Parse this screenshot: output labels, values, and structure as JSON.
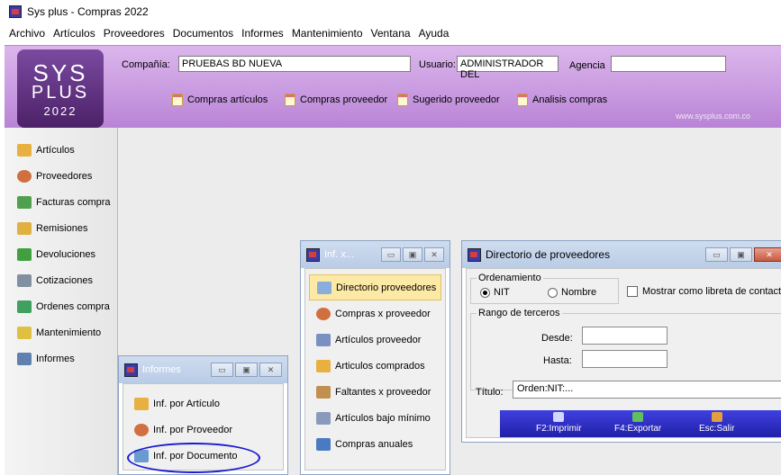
{
  "window": {
    "title": "Sys plus - Compras 2022"
  },
  "menu": [
    "Archivo",
    "Artículos",
    "Proveedores",
    "Documentos",
    "Informes",
    "Mantenimiento",
    "Ventana",
    "Ayuda"
  ],
  "logo": {
    "line1": "SYS",
    "line2": "PLUS",
    "year": "2022"
  },
  "header": {
    "company_label": "Compañía:",
    "company_value": "PRUEBAS BD NUEVA",
    "user_label": "Usuario:",
    "user_value": "ADMINISTRADOR DEL",
    "agency_label": "Agencia",
    "agency_value": "",
    "url": "www.sysplus.com.co"
  },
  "toolbar": [
    "Compras artículos",
    "Compras proveedor",
    "Sugerido proveedor",
    "Analisis compras"
  ],
  "sidebar": [
    {
      "label": "Artículos",
      "icon": "box-icon",
      "color": "#e8b040"
    },
    {
      "label": "Proveedores",
      "icon": "person-icon",
      "color": "#d07040"
    },
    {
      "label": "Facturas compra",
      "icon": "invoice-icon",
      "color": "#50a050"
    },
    {
      "label": "Remisiones",
      "icon": "remission-icon",
      "color": "#e0b040"
    },
    {
      "label": "Devoluciones",
      "icon": "return-icon",
      "color": "#40a040"
    },
    {
      "label": "Cotizaciones",
      "icon": "quote-icon",
      "color": "#8090a0"
    },
    {
      "label": "Ordenes compra",
      "icon": "order-icon",
      "color": "#40a060"
    },
    {
      "label": "Mantenimiento",
      "icon": "wrench-icon",
      "color": "#e0c040"
    },
    {
      "label": "Informes",
      "icon": "printer-icon",
      "color": "#6080b0"
    }
  ],
  "informes": {
    "title": "Informes",
    "items": [
      "Inf. por Artículo",
      "Inf. por Proveedor",
      "Inf. por Documento"
    ]
  },
  "infx": {
    "title": "Inf. x...",
    "items": [
      "Directorio proveedores",
      "Compras x proveedor",
      "Artículos proveedor",
      "Articulos comprados",
      "Faltantes x proveedor",
      "Artículos bajo mínimo",
      "Compras anuales"
    ]
  },
  "directorio": {
    "title": "Directorio de proveedores",
    "ordering_label": "Ordenamiento",
    "opt_nit": "NIT",
    "opt_nombre": "Nombre",
    "checkbox_label": "Mostrar como libreta de contactos",
    "range_label": "Rango de terceros",
    "desde_label": "Desde:",
    "hasta_label": "Hasta:",
    "titulo_label": "Título:",
    "titulo_value": "Orden:NIT:...",
    "btn_print": "F2:Imprimir",
    "btn_export": "F4:Exportar",
    "btn_exit": "Esc:Salir"
  }
}
